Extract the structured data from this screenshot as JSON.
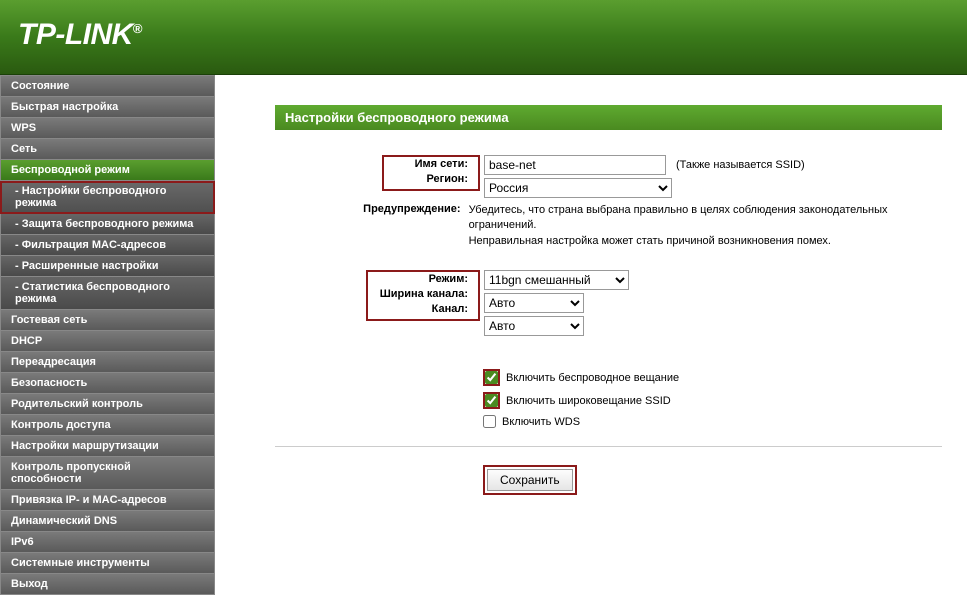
{
  "brand": "TP-LINK",
  "sidebar": {
    "items": [
      {
        "label": "Состояние",
        "type": "item"
      },
      {
        "label": "Быстрая настройка",
        "type": "item"
      },
      {
        "label": "WPS",
        "type": "item"
      },
      {
        "label": "Сеть",
        "type": "item"
      },
      {
        "label": "Беспроводной режим",
        "type": "item",
        "section_active": true
      },
      {
        "label": "- Настройки беспроводного режима",
        "type": "subitem",
        "active": true,
        "highlight": true
      },
      {
        "label": "- Защита беспроводного режима",
        "type": "subitem"
      },
      {
        "label": "- Фильтрация MAC-адресов",
        "type": "subitem"
      },
      {
        "label": "- Расширенные настройки",
        "type": "subitem"
      },
      {
        "label": "- Статистика беспроводного режима",
        "type": "subitem"
      },
      {
        "label": "Гостевая сеть",
        "type": "item"
      },
      {
        "label": "DHCP",
        "type": "item"
      },
      {
        "label": "Переадресация",
        "type": "item"
      },
      {
        "label": "Безопасность",
        "type": "item"
      },
      {
        "label": "Родительский контроль",
        "type": "item"
      },
      {
        "label": "Контроль доступа",
        "type": "item"
      },
      {
        "label": "Настройки маршрутизации",
        "type": "item"
      },
      {
        "label": "Контроль пропускной способности",
        "type": "item"
      },
      {
        "label": "Привязка IP- и MAC-адресов",
        "type": "item"
      },
      {
        "label": "Динамический DNS",
        "type": "item"
      },
      {
        "label": "IPv6",
        "type": "item"
      },
      {
        "label": "Системные инструменты",
        "type": "item"
      },
      {
        "label": "Выход",
        "type": "item"
      }
    ]
  },
  "panel": {
    "title": "Настройки беспроводного режима",
    "ssid_label": "Имя сети:",
    "ssid_value": "base-net",
    "ssid_hint": "(Также называется SSID)",
    "region_label": "Регион:",
    "region_value": "Россия",
    "warning_label": "Предупреждение:",
    "warning_text": "Убедитесь, что страна выбрана правильно в целях соблюдения законодательных ограничений.\nНеправильная настройка может стать причиной возникновения помех.",
    "mode_label": "Режим:",
    "mode_value": "11bgn смешанный",
    "width_label": "Ширина канала:",
    "width_value": "Авто",
    "channel_label": "Канал:",
    "channel_value": "Авто",
    "cb1": "Включить беспроводное вещание",
    "cb2": "Включить широковещание SSID",
    "cb3": "Включить WDS",
    "save": "Сохранить"
  }
}
